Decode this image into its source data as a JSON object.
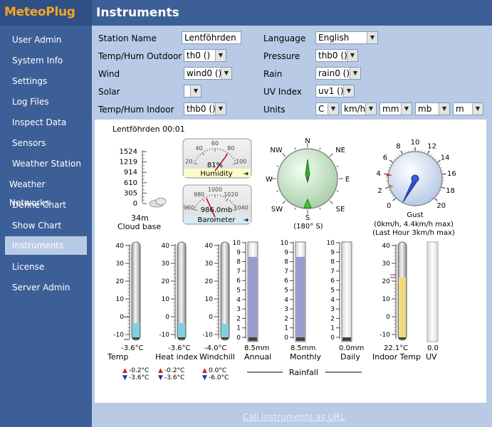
{
  "app": {
    "brand": "MeteoPlug",
    "page_title": "Instruments"
  },
  "sidebar": {
    "items": [
      {
        "label": "User Admin"
      },
      {
        "label": "System Info"
      },
      {
        "label": "Settings"
      },
      {
        "label": "Log Files"
      },
      {
        "label": "Inspect Data"
      },
      {
        "label": "Sensors"
      },
      {
        "label": "Weather Station"
      },
      {
        "label": "Weather Networks"
      },
      {
        "label": "Define Chart"
      },
      {
        "label": "Show Chart"
      },
      {
        "label": "Instruments",
        "active": true
      },
      {
        "label": "License"
      },
      {
        "label": "Server Admin"
      }
    ]
  },
  "form": {
    "station_name": {
      "label": "Station Name",
      "value": "Lentföhrden"
    },
    "temp_hum_outdoor": {
      "label": "Temp/Hum Outdoor",
      "value": "th0 ()"
    },
    "wind": {
      "label": "Wind",
      "value": "wind0 ()"
    },
    "solar": {
      "label": "Solar",
      "value": ""
    },
    "temp_hum_indoor": {
      "label": "Temp/Hum Indoor",
      "value": "thb0 ()"
    },
    "language": {
      "label": "Language",
      "value": "English"
    },
    "pressure": {
      "label": "Pressure",
      "value": "thb0 ()"
    },
    "rain": {
      "label": "Rain",
      "value": "rain0 ()"
    },
    "uv_index": {
      "label": "UV Index",
      "value": "uv1 ()"
    },
    "units": {
      "label": "Units",
      "values": [
        "C",
        "km/h",
        "mm",
        "mb",
        "m"
      ]
    }
  },
  "header": {
    "station_time": "Lentföhrden 00:01"
  },
  "cloud_base": {
    "ticks": [
      "1524",
      "1219",
      "914",
      "610",
      "305",
      "0"
    ],
    "value": "34m",
    "label": "Cloud base"
  },
  "humidity": {
    "value": "81%",
    "label": "Humidity",
    "ticks": [
      "20",
      "40",
      "60",
      "80",
      "100"
    ],
    "level": 81
  },
  "barometer": {
    "value": "986.0mb",
    "label": "Barometer",
    "ticks": [
      "960",
      "980",
      "1000",
      "1020",
      "1040"
    ],
    "level": 986.0
  },
  "compass": {
    "directions": [
      "N",
      "NE",
      "E",
      "SE",
      "S",
      "SW",
      "W",
      "NW"
    ],
    "heading": "S",
    "degrees": "(180° S)",
    "bearing": 180
  },
  "wind_gauge": {
    "ticks": [
      "0",
      "2",
      "4",
      "6",
      "8",
      "10",
      "12",
      "14",
      "16",
      "18",
      "20"
    ],
    "label": "Gust",
    "summary": "(0km/h, 4.4km/h max)",
    "last_hour": "(Last Hour 3km/h max)",
    "value": 4.4
  },
  "thermometers": {
    "ticks": [
      "40",
      "30",
      "20",
      "10",
      "0",
      "-10"
    ],
    "items": [
      {
        "value": "-3.6°C",
        "label": "Temp",
        "reading": -3.6,
        "high": "-0.2°C",
        "low": "-3.6°C"
      },
      {
        "value": "-3.6°C",
        "label": "Heat index",
        "reading": -3.6,
        "high": "-0.2°C",
        "low": "-3.6°C"
      },
      {
        "value": "-4.0°C",
        "label": "Windchill",
        "reading": -4.0,
        "high": "0.0°C",
        "low": "-6.0°C"
      }
    ]
  },
  "rain_ticks": [
    "10",
    "9",
    "8",
    "7",
    "6",
    "5",
    "4",
    "3",
    "2",
    "1",
    "0"
  ],
  "rain_gauges": [
    {
      "value": "8.5mm",
      "label": "Annual",
      "level": 8.5
    },
    {
      "value": "8.5mm",
      "label": "Monthly",
      "level": 8.5
    },
    {
      "value": "0.0mm",
      "label": "Daily",
      "level": 0.0
    }
  ],
  "rainfall_label": "Rainfall",
  "indoor_temp": {
    "value": "22.1°C",
    "label": "Indoor Temp",
    "reading": 22.1
  },
  "uv": {
    "value": "0.0",
    "label": "UV",
    "level": 0
  },
  "footer": {
    "link": "Call instruments as URL"
  },
  "colors": {
    "brand": "#f5a623",
    "nav_bg": "#3d5f97",
    "main_bg": "#b8cae6",
    "temp_fill": "#7fd0e0",
    "rain_fill": "#9b9bd0",
    "indoor_fill": "#f0dc80"
  }
}
